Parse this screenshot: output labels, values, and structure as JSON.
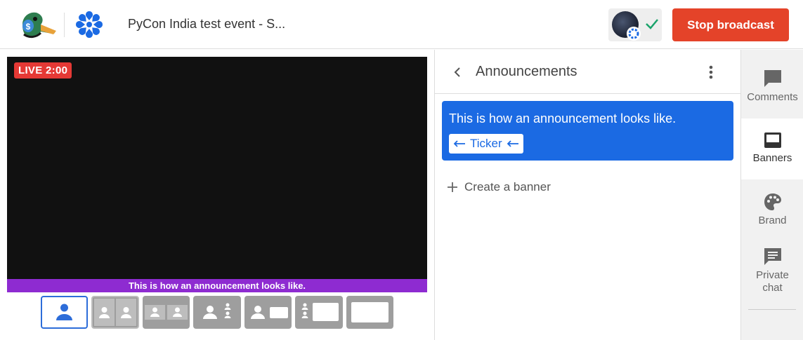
{
  "header": {
    "event_title": "PyCon India test event - S...",
    "stop_button_label": "Stop broadcast"
  },
  "stage": {
    "live_badge": "LIVE 2:00",
    "ticker_text": "This is how an announcement looks like."
  },
  "panel": {
    "title": "Announcements",
    "banners": [
      {
        "text": "This is how an announcement looks like.",
        "style_label": "Ticker"
      }
    ],
    "create_label": "Create a banner"
  },
  "rail": {
    "items": [
      {
        "label": "Comments",
        "icon": "comment-icon"
      },
      {
        "label": "Banners",
        "icon": "banner-icon",
        "active": true
      },
      {
        "label": "Brand",
        "icon": "palette-icon"
      },
      {
        "label1": "Private",
        "label2": "chat",
        "icon": "chat-icon"
      }
    ]
  },
  "colors": {
    "accent_blue": "#1b6ae3",
    "stop_red": "#e44329",
    "live_red": "#e53935",
    "ticker_purple": "#8e2bd1"
  }
}
